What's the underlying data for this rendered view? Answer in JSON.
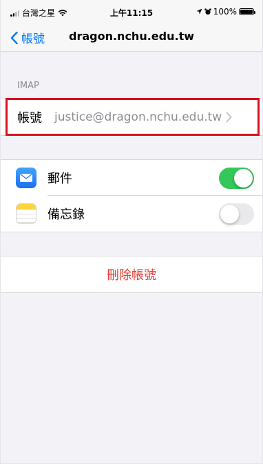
{
  "status_bar": {
    "carrier": "台灣之星",
    "time": "上午11:15",
    "battery_percent": "100%"
  },
  "nav": {
    "back_label": "帳號",
    "title": "dragon.nchu.edu.tw"
  },
  "imap_section": {
    "header": "IMAP",
    "account_label": "帳號",
    "account_value": "justice@dragon.nchu.edu.tw"
  },
  "services": [
    {
      "label": "郵件",
      "enabled": true
    },
    {
      "label": "備忘錄",
      "enabled": false
    }
  ],
  "delete_account_label": "刪除帳號",
  "colors": {
    "accent": "#007aff",
    "toggle_on": "#34c759",
    "destructive": "#e33a2f",
    "highlight_box": "#d8101e"
  }
}
